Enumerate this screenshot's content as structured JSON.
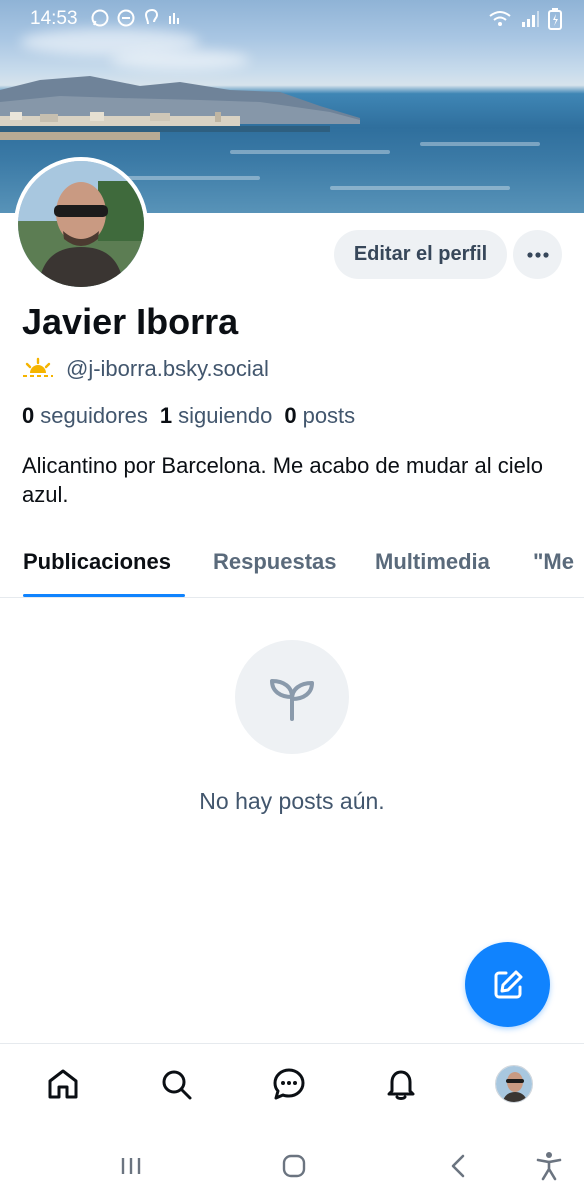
{
  "status_bar": {
    "time": "14:53",
    "left_icons": [
      "whatsapp-icon",
      "do-not-disturb-icon",
      "hearing-icon",
      "notification-icon"
    ],
    "right_icons": [
      "wifi-icon",
      "signal-icon",
      "battery-icon"
    ]
  },
  "profile": {
    "name": "Javier Iborra",
    "handle": "@j-iborra.bsky.social",
    "handle_icon": "sun-icon",
    "stats": {
      "followers_count": "0",
      "followers_label": "seguidores",
      "following_count": "1",
      "following_label": "siguiendo",
      "posts_count": "0",
      "posts_label": "posts"
    },
    "bio": "Alicantino por Barcelona. Me acabo de mudar al cielo azul.",
    "edit_button": "Editar el perfil"
  },
  "tabs": [
    {
      "label": "Publicaciones",
      "active": true
    },
    {
      "label": "Respuestas",
      "active": false
    },
    {
      "label": "Multimedia",
      "active": false
    },
    {
      "label": "\"Me",
      "active": false
    }
  ],
  "empty_state": {
    "icon": "sprout-icon",
    "text": "No hay posts aún."
  },
  "fab": {
    "icon": "compose-icon"
  },
  "bottom_nav": [
    "home-icon",
    "search-icon",
    "chat-icon",
    "bell-icon",
    "profile-avatar"
  ],
  "system_nav": [
    "recents-icon",
    "home-icon",
    "back-icon",
    "accessibility-icon"
  ],
  "colors": {
    "accent": "#1083fe",
    "muted_text": "#42566d",
    "button_bg": "#eef1f4"
  }
}
